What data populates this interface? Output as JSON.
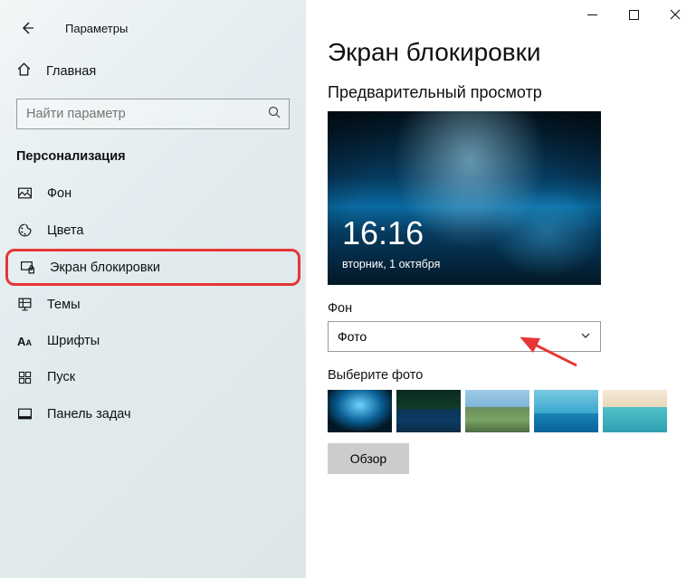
{
  "window_title": "Параметры",
  "sidebar": {
    "home_label": "Главная",
    "search_placeholder": "Найти параметр",
    "category": "Персонализация",
    "items": [
      {
        "label": "Фон"
      },
      {
        "label": "Цвета"
      },
      {
        "label": "Экран блокировки",
        "highlighted": true
      },
      {
        "label": "Темы"
      },
      {
        "label": "Шрифты"
      },
      {
        "label": "Пуск"
      },
      {
        "label": "Панель задач"
      }
    ]
  },
  "main": {
    "page_title": "Экран блокировки",
    "preview_label": "Предварительный просмотр",
    "clock": "16:16",
    "date": "вторник, 1 октября",
    "bg_field_label": "Фон",
    "bg_dropdown_value": "Фото",
    "choose_label": "Выберите фото",
    "browse_label": "Обзор"
  }
}
